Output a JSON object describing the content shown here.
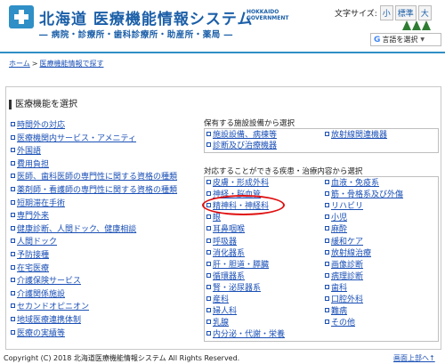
{
  "header": {
    "title": "北海道 医療機能情報システム",
    "title_en": "HOKKAIDO GOVERNMENT",
    "subtitle": "― 病院・診療所・歯科診療所・助産所・薬局 ―",
    "font_size_label": "文字サイズ:",
    "font_sizes": [
      "小",
      "標準",
      "大"
    ],
    "translate_label": "言語を選択",
    "translate_icon": "google-g-icon"
  },
  "breadcrumb": {
    "home": "ホーム",
    "separator": ">",
    "current": "医療機能情報で探す"
  },
  "section_title": "医療機能を選択",
  "left_links": [
    "時間外の対応",
    "医療機関内サービス・アメニティ",
    "外国語",
    "費用負担",
    "医師、歯科医師の専門性に関する資格の種類",
    "薬剤師・看護師の専門性に関する資格の種類",
    "短期滞在手術",
    "専門外来",
    "健康診断、人間ドック、健康相談",
    "人間ドック",
    "予防接種",
    "在宅医療",
    "介護保険サービス",
    "介護関係施設",
    "セカンドオピニオン",
    "地域医療連携体制",
    "医療の実績等"
  ],
  "facilities_group": {
    "title": "保有する施設設備から選択",
    "items": [
      "施設設備、病棟等",
      "放射線関連機器",
      "診断及び治療機器"
    ]
  },
  "diseases_group": {
    "title": "対応することができる疾患・治療内容から選択",
    "col1": [
      "皮膚・形成外科",
      "神経・脳血管",
      "精神科・神経科",
      "眼",
      "耳鼻咽喉",
      "呼吸器",
      "消化器系",
      "肝・胆道・膵臓",
      "循環器系",
      "腎・泌尿器系",
      "産科",
      "婦人科",
      "乳腺",
      "内分泌・代謝・栄養"
    ],
    "col2": [
      "血液・免疫系",
      "筋・骨格系及び外傷",
      "リハビリ",
      "小児",
      "麻酔",
      "緩和ケア",
      "放射線治療",
      "画像診断",
      "病理診断",
      "歯科",
      "口腔外科",
      "難病",
      "その他"
    ]
  },
  "footer": {
    "copyright": "Copyright (C) 2018 北海道医療機能情報システム All Rights Reserved.",
    "to_top": "画面上部へ"
  },
  "colors": {
    "brand_blue": "#1b5fa8",
    "link_blue": "#1a4fb5",
    "highlight_red": "#e01010"
  }
}
